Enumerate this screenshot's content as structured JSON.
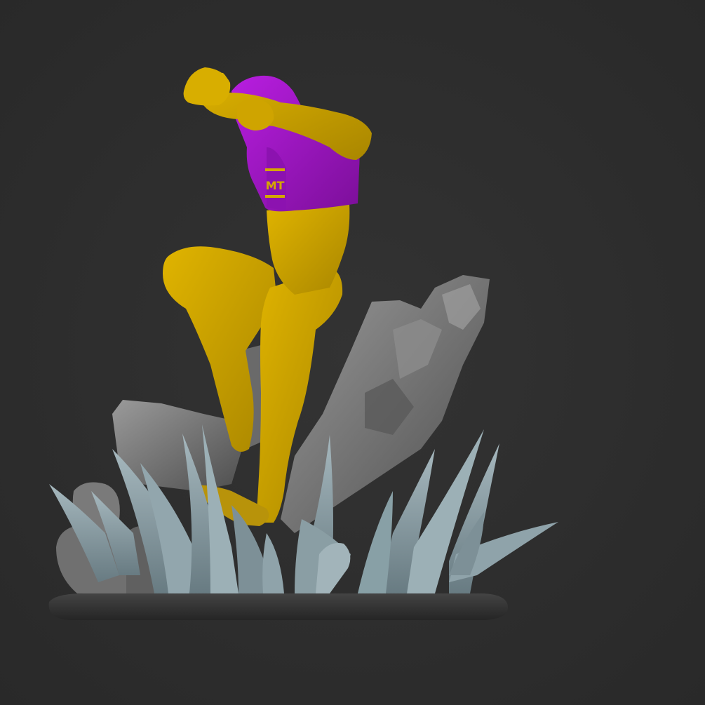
{
  "viewport": {
    "background_color": "#2e2e2e"
  },
  "model": {
    "chest_logo_text": "MT",
    "colors": {
      "skin": "#d4a800",
      "skin_shadow": "#a88400",
      "hood": "#a415c9",
      "hood_shadow": "#7a0e98",
      "rock": "#7d7d7d",
      "rock_dark": "#555555",
      "spikes": "#8fa3aa",
      "spikes_dark": "#6b7e85",
      "base": "#3a3a3a",
      "back_rock": "#6e6e6e"
    }
  }
}
